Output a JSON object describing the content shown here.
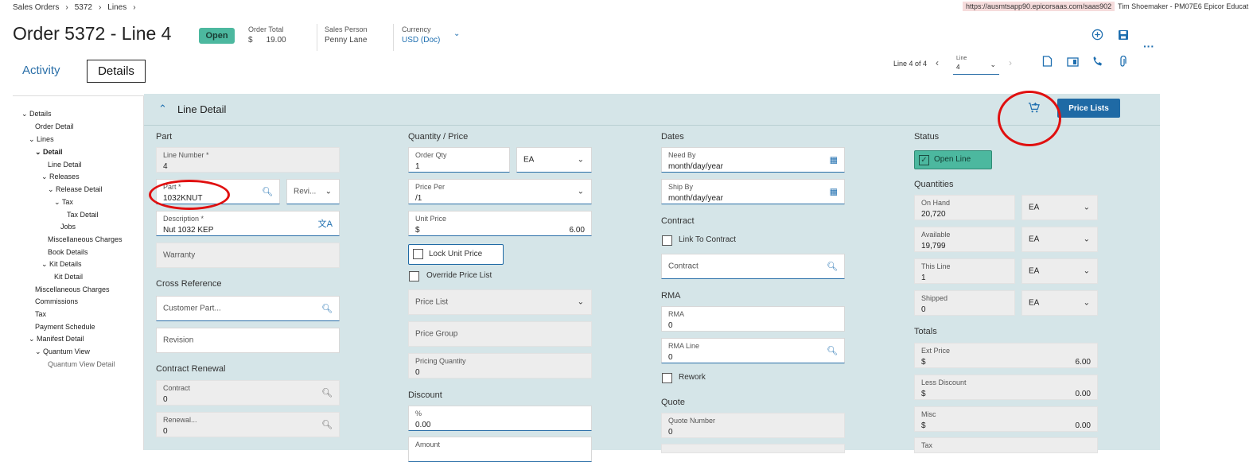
{
  "breadcrumb": [
    "Sales Orders",
    "5372",
    "Lines"
  ],
  "url": "https://ausmtsapp90.epicorsaas.com/saas902",
  "user": "Tim Shoemaker - PM07E6   Epicor Educat",
  "header": {
    "title": "Order 5372 - Line 4",
    "status": "Open",
    "order_total_label": "Order Total",
    "order_total_currency": "$",
    "order_total_value": "19.00",
    "sales_person_label": "Sales Person",
    "sales_person_value": "Penny Lane",
    "currency_label": "Currency",
    "currency_value": "USD (Doc)"
  },
  "tabs": {
    "activity": "Activity",
    "details": "Details"
  },
  "line_nav": {
    "label": "Line 4 of 4",
    "field_label": "Line",
    "field_value": "4"
  },
  "tree": [
    "Details",
    "Order Detail",
    "Lines",
    "Detail",
    "Line Detail",
    "Releases",
    "Release Detail",
    "Tax",
    "Tax Detail",
    "Jobs",
    "Miscellaneous Charges",
    "Book Details",
    "Kit Details",
    "Kit Detail",
    "Miscellaneous Charges",
    "Commissions",
    "Tax",
    "Payment Schedule",
    "Manifest Detail",
    "Quantum View",
    "Quantum View Detail"
  ],
  "panel": {
    "title": "Line Detail",
    "price_lists_button": "Price Lists"
  },
  "part": {
    "section": "Part",
    "line_number_label": "Line Number *",
    "line_number_value": "4",
    "part_label": "Part *",
    "part_value": "1032KNUT",
    "revision_placeholder": "Revi...",
    "description_label": "Description *",
    "description_value": "Nut 1032 KEP",
    "warranty": "Warranty",
    "cross_ref_section": "Cross Reference",
    "customer_part": "Customer Part...",
    "revision": "Revision",
    "contract_renewal_section": "Contract Renewal",
    "contract_label": "Contract",
    "contract_value": "0",
    "renewal_label": "Renewal...",
    "renewal_value": "0"
  },
  "qty": {
    "section": "Quantity / Price",
    "order_qty_label": "Order Qty",
    "order_qty_value": "1",
    "uom": "EA",
    "price_per_label": "Price Per",
    "price_per_value": "/1",
    "unit_price_label": "Unit Price",
    "unit_price_currency": "$",
    "unit_price_value": "6.00",
    "lock_unit_price": "Lock Unit Price",
    "override_price_list": "Override Price List",
    "price_list": "Price List",
    "price_group": "Price Group",
    "pricing_qty_label": "Pricing Quantity",
    "pricing_qty_value": "0",
    "discount_section": "Discount",
    "pct_label": "%",
    "pct_value": "0.00",
    "amount_label": "Amount"
  },
  "dates": {
    "section": "Dates",
    "need_by_label": "Need By",
    "need_by_value": "month/day/year",
    "ship_by_label": "Ship By",
    "ship_by_value": "month/day/year",
    "contract_section": "Contract",
    "link_to_contract": "Link To Contract",
    "contract": "Contract",
    "rma_section": "RMA",
    "rma_label": "RMA",
    "rma_value": "0",
    "rma_line_label": "RMA Line",
    "rma_line_value": "0",
    "rework": "Rework",
    "quote_section": "Quote",
    "quote_number_label": "Quote Number",
    "quote_number_value": "0"
  },
  "status": {
    "section": "Status",
    "open_line": "Open Line",
    "quantities_section": "Quantities",
    "on_hand_label": "On Hand",
    "on_hand_value": "20,720",
    "available_label": "Available",
    "available_value": "19,799",
    "this_line_label": "This Line",
    "this_line_value": "1",
    "shipped_label": "Shipped",
    "shipped_value": "0",
    "uom": "EA",
    "totals_section": "Totals",
    "ext_price_label": "Ext Price",
    "ext_price_value": "6.00",
    "less_discount_label": "Less Discount",
    "less_discount_value": "0.00",
    "misc_label": "Misc",
    "misc_value": "0.00",
    "tax_label": "Tax",
    "currency": "$"
  }
}
